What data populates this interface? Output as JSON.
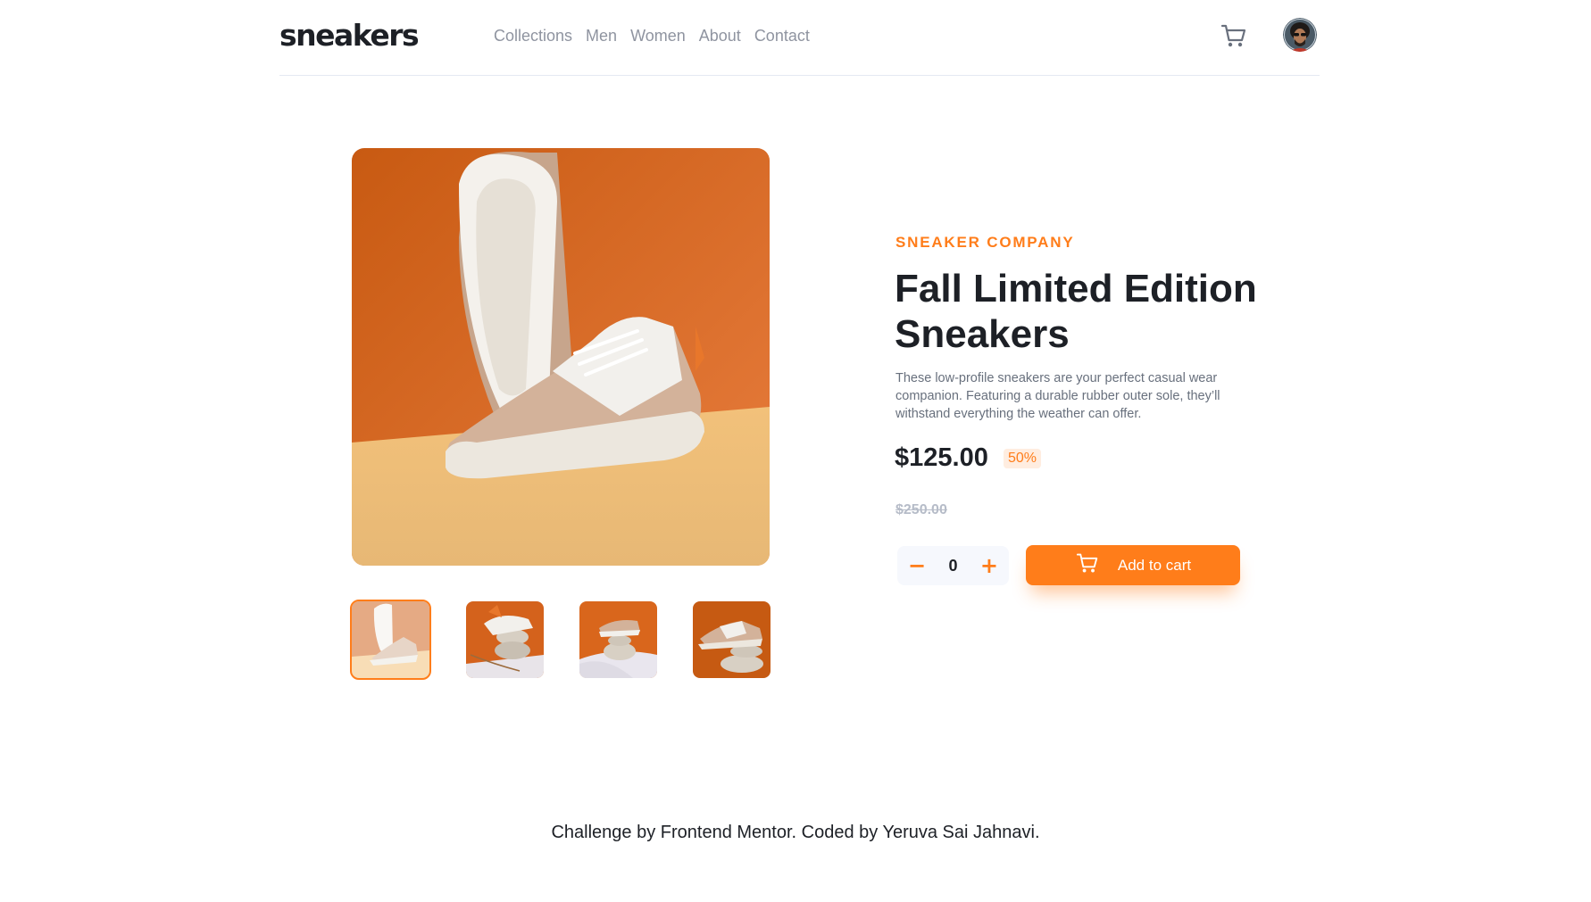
{
  "brand": {
    "logo": "sneakers"
  },
  "nav": {
    "items": [
      {
        "label": "Collections"
      },
      {
        "label": "Men"
      },
      {
        "label": "Women"
      },
      {
        "label": "About"
      },
      {
        "label": "Contact"
      }
    ]
  },
  "header": {
    "cart_icon": "cart-icon",
    "avatar_icon": "user-avatar"
  },
  "product": {
    "company": "SNEAKER COMPANY",
    "title": "Fall Limited Edition Sneakers",
    "description": "These low-profile sneakers are your perfect casual wear companion. Featuring a durable rubber outer sole, they’ll withstand everything the weather can offer.",
    "price": "$125.00",
    "discount": "50%",
    "original_price": "$250.00",
    "quantity": "0",
    "decrement_label": "−",
    "increment_label": "+",
    "add_to_cart_label": "Add to cart",
    "active_thumbnail": 1
  },
  "colors": {
    "accent": "#ff7d1a",
    "accent_light": "#ffede0",
    "text_dark": "#1d2026",
    "text_muted": "#68707d"
  },
  "footer": {
    "credit": "Challenge by Frontend Mentor. Coded by Yeruva Sai Jahnavi."
  }
}
